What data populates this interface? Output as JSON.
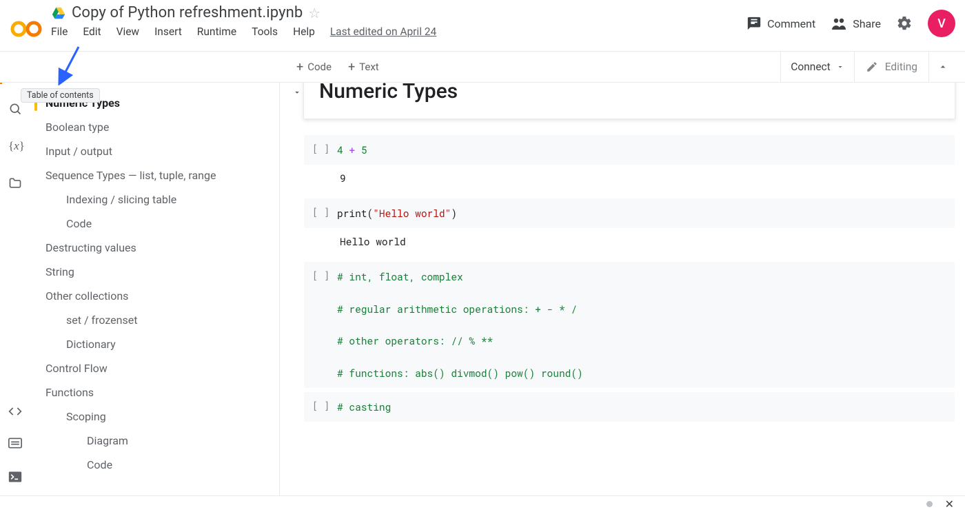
{
  "header": {
    "title": "Copy of Python refreshment.ipynb",
    "menu": {
      "file": "File",
      "edit": "Edit",
      "view": "View",
      "insert": "Insert",
      "runtime": "Runtime",
      "tools": "Tools",
      "help": "Help",
      "last_edit": "Last edited on April 24"
    },
    "actions": {
      "comment": "Comment",
      "share": "Share"
    },
    "avatar_initial": "V"
  },
  "toolbar": {
    "add_code": "Code",
    "add_text": "Text",
    "connect": "Connect",
    "editing": "Editing"
  },
  "toc": {
    "title": "Table of contents",
    "tooltip": "Table of contents",
    "items": [
      {
        "label": "Numeric Types",
        "level": 0,
        "active": true
      },
      {
        "label": "Boolean type",
        "level": 0
      },
      {
        "label": "Input / output",
        "level": 0
      },
      {
        "label": "Sequence Types — list, tuple, range",
        "level": 0
      },
      {
        "label": "Indexing / slicing table",
        "level": 1
      },
      {
        "label": "Code",
        "level": 1
      },
      {
        "label": "Destructing values",
        "level": 0
      },
      {
        "label": "String",
        "level": 0
      },
      {
        "label": "Other collections",
        "level": 0
      },
      {
        "label": "set / frozenset",
        "level": 1
      },
      {
        "label": "Dictionary",
        "level": 1
      },
      {
        "label": "Control Flow",
        "level": 0
      },
      {
        "label": "Functions",
        "level": 0
      },
      {
        "label": "Scoping",
        "level": 1
      },
      {
        "label": "Diagram",
        "level": 2
      },
      {
        "label": "Code",
        "level": 2
      }
    ]
  },
  "notebook": {
    "heading": "Numeric Types",
    "gutter": "[ ]",
    "cells": {
      "c1": {
        "n1": "4",
        "op": "+",
        "n2": "5",
        "out": "9"
      },
      "c2": {
        "fn": "print",
        "open": "(",
        "str": "\"Hello world\"",
        "close": ")",
        "out": "Hello world"
      },
      "c3": {
        "l1": "# int, float, complex",
        "l2": "# regular arithmetic operations: + - * /",
        "l3": "# other operators: // % **",
        "l4": "# functions: abs() divmod() pow() round()"
      },
      "c4": {
        "l1": "# casting"
      }
    }
  }
}
